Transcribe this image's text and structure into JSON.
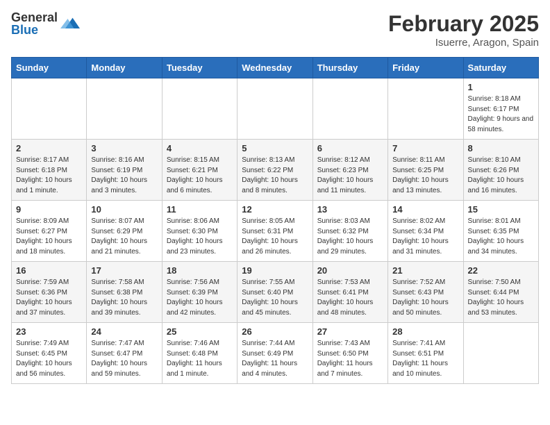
{
  "logo": {
    "general": "General",
    "blue": "Blue"
  },
  "title": "February 2025",
  "location": "Isuerre, Aragon, Spain",
  "days_of_week": [
    "Sunday",
    "Monday",
    "Tuesday",
    "Wednesday",
    "Thursday",
    "Friday",
    "Saturday"
  ],
  "weeks": [
    [
      {
        "day": "",
        "info": ""
      },
      {
        "day": "",
        "info": ""
      },
      {
        "day": "",
        "info": ""
      },
      {
        "day": "",
        "info": ""
      },
      {
        "day": "",
        "info": ""
      },
      {
        "day": "",
        "info": ""
      },
      {
        "day": "1",
        "info": "Sunrise: 8:18 AM\nSunset: 6:17 PM\nDaylight: 9 hours and 58 minutes."
      }
    ],
    [
      {
        "day": "2",
        "info": "Sunrise: 8:17 AM\nSunset: 6:18 PM\nDaylight: 10 hours and 1 minute."
      },
      {
        "day": "3",
        "info": "Sunrise: 8:16 AM\nSunset: 6:19 PM\nDaylight: 10 hours and 3 minutes."
      },
      {
        "day": "4",
        "info": "Sunrise: 8:15 AM\nSunset: 6:21 PM\nDaylight: 10 hours and 6 minutes."
      },
      {
        "day": "5",
        "info": "Sunrise: 8:13 AM\nSunset: 6:22 PM\nDaylight: 10 hours and 8 minutes."
      },
      {
        "day": "6",
        "info": "Sunrise: 8:12 AM\nSunset: 6:23 PM\nDaylight: 10 hours and 11 minutes."
      },
      {
        "day": "7",
        "info": "Sunrise: 8:11 AM\nSunset: 6:25 PM\nDaylight: 10 hours and 13 minutes."
      },
      {
        "day": "8",
        "info": "Sunrise: 8:10 AM\nSunset: 6:26 PM\nDaylight: 10 hours and 16 minutes."
      }
    ],
    [
      {
        "day": "9",
        "info": "Sunrise: 8:09 AM\nSunset: 6:27 PM\nDaylight: 10 hours and 18 minutes."
      },
      {
        "day": "10",
        "info": "Sunrise: 8:07 AM\nSunset: 6:29 PM\nDaylight: 10 hours and 21 minutes."
      },
      {
        "day": "11",
        "info": "Sunrise: 8:06 AM\nSunset: 6:30 PM\nDaylight: 10 hours and 23 minutes."
      },
      {
        "day": "12",
        "info": "Sunrise: 8:05 AM\nSunset: 6:31 PM\nDaylight: 10 hours and 26 minutes."
      },
      {
        "day": "13",
        "info": "Sunrise: 8:03 AM\nSunset: 6:32 PM\nDaylight: 10 hours and 29 minutes."
      },
      {
        "day": "14",
        "info": "Sunrise: 8:02 AM\nSunset: 6:34 PM\nDaylight: 10 hours and 31 minutes."
      },
      {
        "day": "15",
        "info": "Sunrise: 8:01 AM\nSunset: 6:35 PM\nDaylight: 10 hours and 34 minutes."
      }
    ],
    [
      {
        "day": "16",
        "info": "Sunrise: 7:59 AM\nSunset: 6:36 PM\nDaylight: 10 hours and 37 minutes."
      },
      {
        "day": "17",
        "info": "Sunrise: 7:58 AM\nSunset: 6:38 PM\nDaylight: 10 hours and 39 minutes."
      },
      {
        "day": "18",
        "info": "Sunrise: 7:56 AM\nSunset: 6:39 PM\nDaylight: 10 hours and 42 minutes."
      },
      {
        "day": "19",
        "info": "Sunrise: 7:55 AM\nSunset: 6:40 PM\nDaylight: 10 hours and 45 minutes."
      },
      {
        "day": "20",
        "info": "Sunrise: 7:53 AM\nSunset: 6:41 PM\nDaylight: 10 hours and 48 minutes."
      },
      {
        "day": "21",
        "info": "Sunrise: 7:52 AM\nSunset: 6:43 PM\nDaylight: 10 hours and 50 minutes."
      },
      {
        "day": "22",
        "info": "Sunrise: 7:50 AM\nSunset: 6:44 PM\nDaylight: 10 hours and 53 minutes."
      }
    ],
    [
      {
        "day": "23",
        "info": "Sunrise: 7:49 AM\nSunset: 6:45 PM\nDaylight: 10 hours and 56 minutes."
      },
      {
        "day": "24",
        "info": "Sunrise: 7:47 AM\nSunset: 6:47 PM\nDaylight: 10 hours and 59 minutes."
      },
      {
        "day": "25",
        "info": "Sunrise: 7:46 AM\nSunset: 6:48 PM\nDaylight: 11 hours and 1 minute."
      },
      {
        "day": "26",
        "info": "Sunrise: 7:44 AM\nSunset: 6:49 PM\nDaylight: 11 hours and 4 minutes."
      },
      {
        "day": "27",
        "info": "Sunrise: 7:43 AM\nSunset: 6:50 PM\nDaylight: 11 hours and 7 minutes."
      },
      {
        "day": "28",
        "info": "Sunrise: 7:41 AM\nSunset: 6:51 PM\nDaylight: 11 hours and 10 minutes."
      },
      {
        "day": "",
        "info": ""
      }
    ]
  ]
}
